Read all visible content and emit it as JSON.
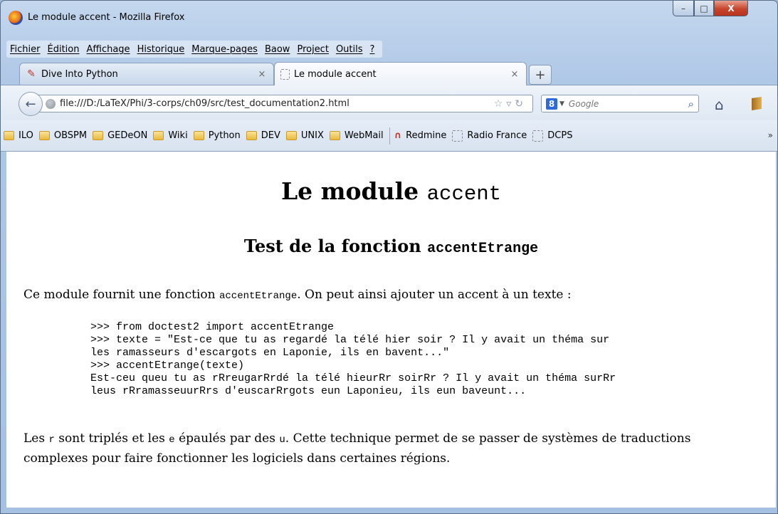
{
  "window": {
    "title": "Le module accent - Mozilla Firefox",
    "minimize": "–",
    "maximize": "□",
    "close": "X"
  },
  "menu": [
    "Fichier",
    "Édition",
    "Affichage",
    "Historique",
    "Marque-pages",
    "Baow",
    "Project",
    "Outils",
    "?"
  ],
  "tabs": [
    {
      "label": "Dive Into Python",
      "close": "×"
    },
    {
      "label": "Le module accent",
      "close": "×"
    }
  ],
  "newtab_label": "+",
  "nav": {
    "url": "file:///D:/LaTeX/Phi/3-corps/ch09/src/test_documentation2.html",
    "url_icons": "☆▿↻",
    "search_placeholder": "Google",
    "search_engine_letter": "8"
  },
  "bookmarks": [
    {
      "label": "ILO",
      "icon": "folder-icon"
    },
    {
      "label": "OBSPM",
      "icon": "folder-icon"
    },
    {
      "label": "GEDeON",
      "icon": "folder-icon"
    },
    {
      "label": "Wiki",
      "icon": "folder-icon"
    },
    {
      "label": "Python",
      "icon": "folder-icon"
    },
    {
      "label": "DEV",
      "icon": "folder-icon"
    },
    {
      "label": "UNIX",
      "icon": "folder-icon"
    },
    {
      "label": "WebMail",
      "icon": "folder-icon"
    },
    {
      "label": "Redmine",
      "icon": "redmine-icon"
    },
    {
      "label": "Radio France",
      "icon": "page-icon"
    },
    {
      "label": "DCPS",
      "icon": "page-icon"
    }
  ],
  "bookmarks_overflow": "»",
  "page": {
    "title_text": "Le module ",
    "title_code": "accent",
    "section_text": "Test de la fonction ",
    "section_code": "accentEtrange",
    "intro_before": "Ce module fournit une fonction ",
    "intro_code": "accentEtrange",
    "intro_after": ". On peut ainsi ajouter un accent à un texte :",
    "code_lines": [
      ">>> from doctest2 import accentEtrange",
      ">>> texte = \"Est-ce que tu as regardé la télé hier soir ? Il y avait un théma sur",
      "les ramasseurs d'escargots en Laponie, ils en bavent...\"",
      ">>> accentEtrange(texte)",
      "Est-ceu queu tu as rRreugarRrdé la télé hieurRr soirRr ? Il y avait un théma surRr",
      "leus rRramasseuurRrs d'euscarRrgots eun Laponieu, ils eun baveunt..."
    ],
    "outro_1": "Les ",
    "outro_code_r": "r",
    "outro_2": " sont triplés et les ",
    "outro_code_e": "e",
    "outro_3": " épaulés par des ",
    "outro_code_u": "u",
    "outro_4": ". Cette technique permet de se passer de systèmes de traductions complexes pour faire fonctionner les logiciels dans certaines régions."
  },
  "colors": {
    "frame": "#aec7e6",
    "close_button": "#c7432c"
  }
}
